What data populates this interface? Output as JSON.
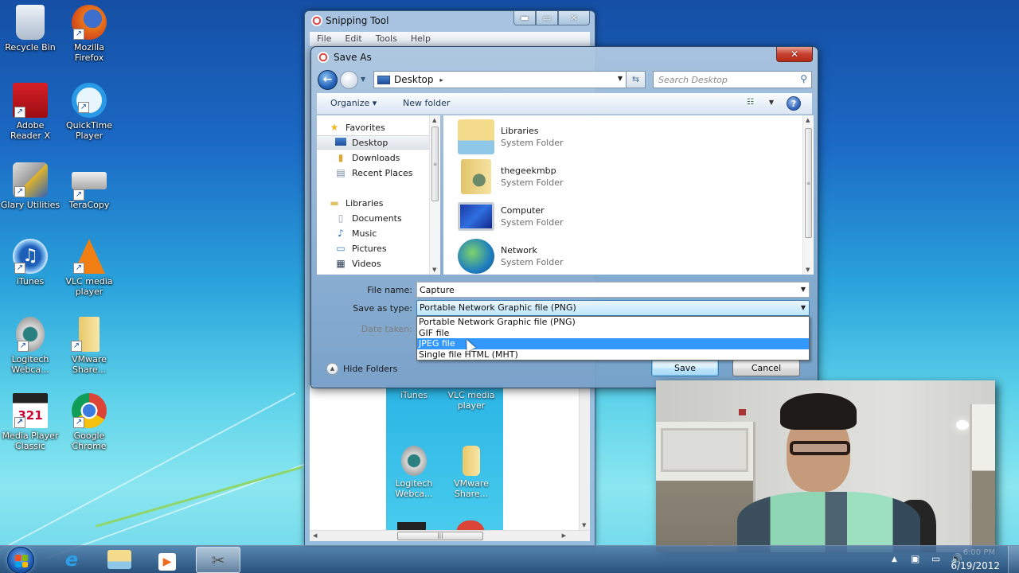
{
  "desktop": {
    "icons": [
      {
        "label": "Recycle Bin",
        "icon": "recycle-bin-icon"
      },
      {
        "label": "Mozilla Firefox",
        "icon": "firefox-icon"
      },
      {
        "label": "Adobe Reader X",
        "icon": "adobe-reader-icon"
      },
      {
        "label": "QuickTime Player",
        "icon": "quicktime-icon"
      },
      {
        "label": "Glary Utilities",
        "icon": "glary-utilities-icon"
      },
      {
        "label": "TeraCopy",
        "icon": "teracopy-icon"
      },
      {
        "label": "iTunes",
        "icon": "itunes-icon"
      },
      {
        "label": "VLC media player",
        "icon": "vlc-icon"
      },
      {
        "label": "Logitech Webca...",
        "icon": "logitech-webcam-icon"
      },
      {
        "label": "VMware Share...",
        "icon": "vmware-shared-folder-icon"
      },
      {
        "label": "Media Player Classic",
        "icon": "media-player-classic-icon"
      },
      {
        "label": "Google Chrome",
        "icon": "chrome-icon"
      }
    ]
  },
  "snipping_tool": {
    "title": "Snipping Tool",
    "menu": [
      "File",
      "Edit",
      "Tools",
      "Help"
    ],
    "window_buttons": {
      "minimize": "▬",
      "maximize": "▭",
      "close": "✕"
    },
    "captured_icons": [
      {
        "label": "iTunes"
      },
      {
        "label": "VLC media player"
      },
      {
        "label": "Logitech Webca..."
      },
      {
        "label": "VMware Share..."
      }
    ]
  },
  "save_dialog": {
    "title": "Save As",
    "close_label": "✕",
    "address": {
      "location": "Desktop",
      "separator": "▸"
    },
    "search": {
      "placeholder": "Search Desktop"
    },
    "toolbar": {
      "organize": "Organize ▾",
      "new_folder": "New folder",
      "help": "?"
    },
    "nav_pane": {
      "favorites_header": "Favorites",
      "favorites": [
        {
          "label": "Desktop",
          "selected": true
        },
        {
          "label": "Downloads",
          "selected": false
        },
        {
          "label": "Recent Places",
          "selected": false
        }
      ],
      "libraries_header": "Libraries",
      "libraries": [
        {
          "label": "Documents"
        },
        {
          "label": "Music"
        },
        {
          "label": "Pictures"
        },
        {
          "label": "Videos"
        }
      ]
    },
    "items": [
      {
        "name": "Libraries",
        "type": "System Folder"
      },
      {
        "name": "thegeekmbp",
        "type": "System Folder"
      },
      {
        "name": "Computer",
        "type": "System Folder"
      },
      {
        "name": "Network",
        "type": "System Folder"
      }
    ],
    "form": {
      "file_name_label": "File name:",
      "file_name_value": "Capture",
      "save_as_type_label": "Save as type:",
      "save_as_type_value": "Portable Network Graphic file (PNG)",
      "date_taken_label": "Date taken:",
      "type_options": [
        {
          "label": "Portable Network Graphic file (PNG)",
          "highlighted": false
        },
        {
          "label": "GIF file",
          "highlighted": false
        },
        {
          "label": "JPEG file",
          "highlighted": true
        },
        {
          "label": "Single file HTML (MHT)",
          "highlighted": false
        }
      ]
    },
    "hide_folders_label": "Hide Folders",
    "save_label": "Save",
    "cancel_label": "Cancel"
  },
  "taskbar": {
    "pinned": [
      {
        "name": "internet-explorer",
        "glyph": "e"
      },
      {
        "name": "windows-explorer",
        "glyph": "📁"
      },
      {
        "name": "windows-media-player",
        "glyph": "▶"
      },
      {
        "name": "snipping-tool",
        "glyph": "✂"
      }
    ],
    "tray": {
      "time": "6:00 PM",
      "date": "6/19/2012"
    }
  }
}
